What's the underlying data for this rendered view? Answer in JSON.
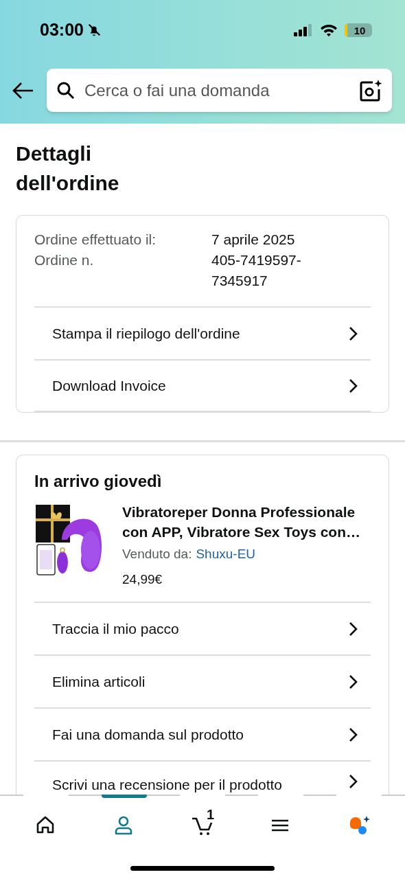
{
  "status_bar": {
    "time": "03:00",
    "battery": "10"
  },
  "search": {
    "placeholder": "Cerca o fai una domanda"
  },
  "title": "Dettagli dell'ordine",
  "order_summary": {
    "fields": [
      {
        "label": "Ordine effettuato il:",
        "value": "7 aprile 2025"
      },
      {
        "label": "Ordine n.",
        "value": "405-7419597-7345917"
      }
    ],
    "actions": [
      "Stampa il riepilogo dell'ordine",
      "Download Invoice"
    ]
  },
  "shipment": {
    "heading": "In arrivo giovedì",
    "item": {
      "title": "Vibratoreper Donna Professionale con APP, Vibratore Sex Toys con…",
      "seller_label": "Venduto da:",
      "seller": "Shuxu-EU",
      "price": "24,99€"
    },
    "actions": [
      "Traccia il mio pacco",
      "Elimina articoli",
      "Fai una domanda sul prodotto",
      "Scrivi una recensione per il prodotto"
    ]
  },
  "bottom_nav": [
    {
      "kind": "home",
      "selected": false
    },
    {
      "kind": "account",
      "selected": true
    },
    {
      "kind": "cart",
      "selected": false,
      "count": "1"
    },
    {
      "kind": "menu",
      "selected": false
    },
    {
      "kind": "assistant",
      "selected": false
    }
  ]
}
